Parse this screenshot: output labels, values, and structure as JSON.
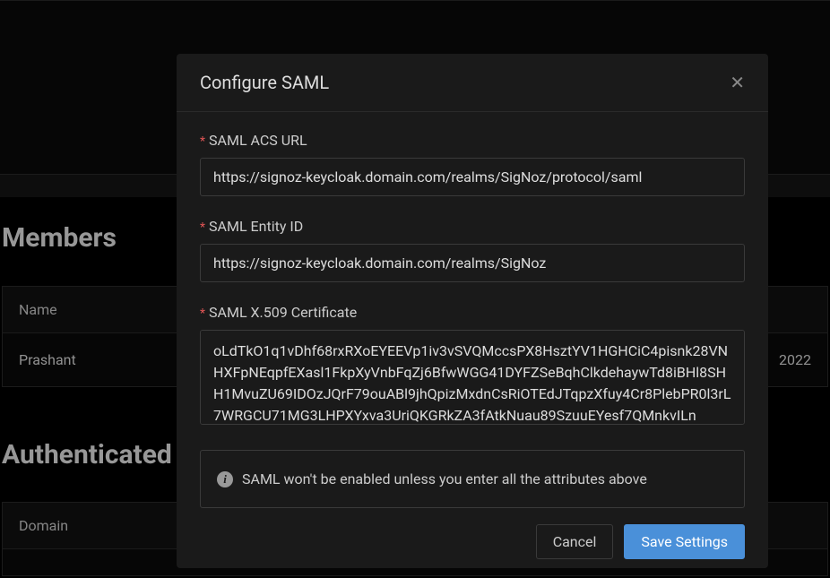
{
  "background": {
    "members_heading": "Members",
    "table": {
      "header_name": "Name",
      "rows": [
        {
          "name": "Prashant",
          "date": "2022"
        }
      ]
    },
    "auth_heading": "Authenticated D",
    "domain_header": "Domain"
  },
  "modal": {
    "title": "Configure SAML",
    "fields": {
      "acs_url": {
        "label": "SAML ACS URL",
        "value": "https://signoz-keycloak.domain.com/realms/SigNoz/protocol/saml"
      },
      "entity_id": {
        "label": "SAML Entity ID",
        "value": "https://signoz-keycloak.domain.com/realms/SigNoz"
      },
      "cert": {
        "label": "SAML X.509 Certificate",
        "value": "oLdTkO1q1vDhf68rxRXoEYEEVp1iv3vSVQMccsPX8HsztYV1HGHCiC4pisnk28VNHXFpNEqpfEXasl1FkpXyVnbFqZj6BfwWGG41DYFZSeBqhClkdehaywTd8iBHl8SHH1MvuZU69IDOzJQrF79ouABl9jhQpizMxdnCsRiOTEdJTqpzXfuy4Cr8PlebPR0l3rL7WRGCU71MG3LHPXYxva3UriQKGRkZA3fAtkNuau89SzuuEYesf7QMnkvILn"
      }
    },
    "info": "SAML won't be enabled unless you enter all the attributes above",
    "buttons": {
      "cancel": "Cancel",
      "save": "Save Settings"
    }
  }
}
